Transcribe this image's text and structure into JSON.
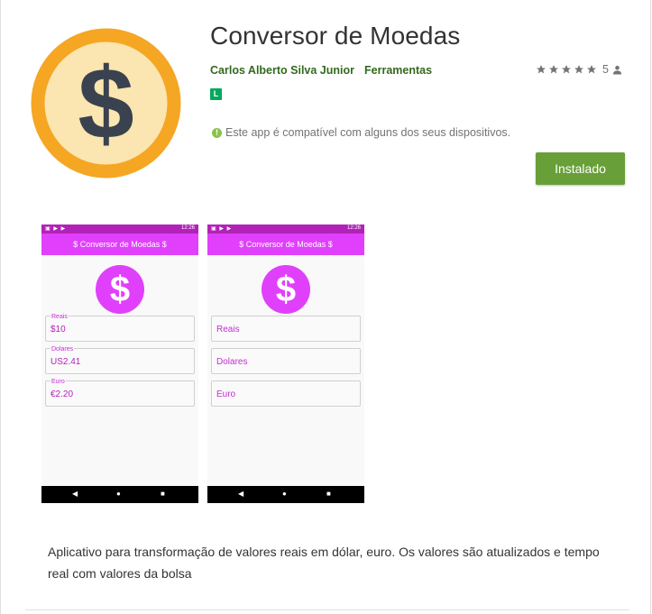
{
  "app": {
    "title": "Conversor de Moedas",
    "developer": "Carlos Alberto Silva Junior",
    "category": "Ferramentas",
    "rating_count": "5",
    "content_rating": "L",
    "compatibility": "Este app é compatível com alguns dos seus dispositivos.",
    "install_label": "Instalado",
    "icon_glyph": "$",
    "description": "Aplicativo para transformação de valores reais em dólar, euro. Os valores são atualizados e tempo real com valores da bolsa"
  },
  "colors": {
    "accent_green": "#689f38",
    "link_green": "#33691e",
    "app_purple": "#e040fb",
    "icon_orange": "#f5a623",
    "icon_cream": "#fbe5b0"
  },
  "screenshots": [
    {
      "status_time": "12:26",
      "toolbar_title": "$ Conversor de Moedas $",
      "fields": [
        {
          "label": "Reais",
          "value": "$10"
        },
        {
          "label": "Dolares",
          "value": "US2.41"
        },
        {
          "label": "Euro",
          "value": "€2.20"
        }
      ]
    },
    {
      "status_time": "12:26",
      "toolbar_title": "$ Conversor de Moedas $",
      "fields": [
        {
          "placeholder": "Reais"
        },
        {
          "placeholder": "Dolares"
        },
        {
          "placeholder": "Euro"
        }
      ]
    }
  ],
  "navbar": {
    "back": "◀",
    "home": "●",
    "recents": "■"
  }
}
